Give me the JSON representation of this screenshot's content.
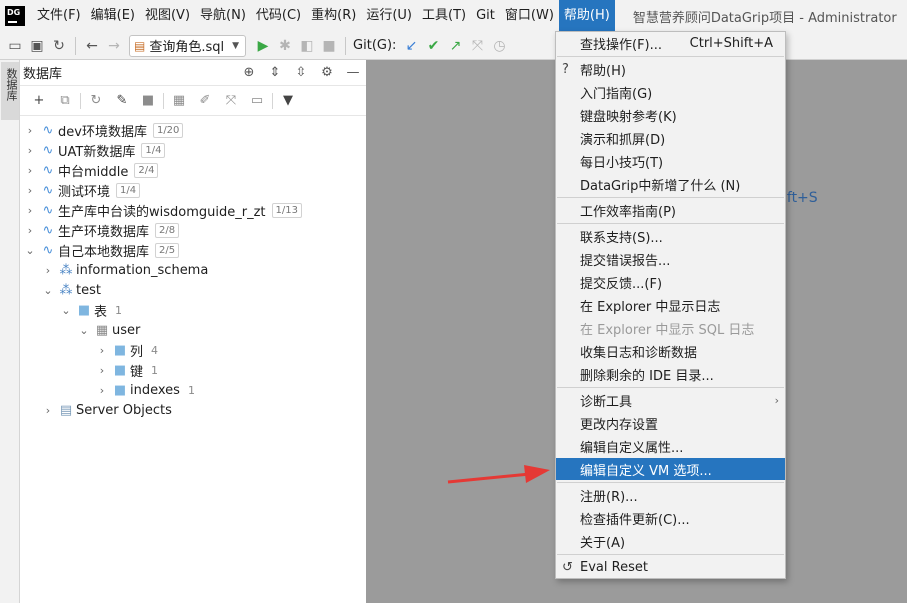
{
  "menubar": {
    "logo": "DG",
    "items": [
      "文件(F)",
      "编辑(E)",
      "视图(V)",
      "导航(N)",
      "代码(C)",
      "重构(R)",
      "运行(U)",
      "工具(T)",
      "Git",
      "窗口(W)",
      "帮助(H)"
    ],
    "active_index": 10,
    "window_title": "智慧营养顾问DataGrip项目 - Administrator"
  },
  "toolbar": {
    "run_config": "查询角色.sql",
    "git_label": "Git(G):"
  },
  "left_strip": {
    "tab_label": "数据库"
  },
  "panel": {
    "title": "数据库",
    "tree": [
      {
        "label": "dev环境数据库",
        "badge": "1/20"
      },
      {
        "label": "UAT新数据库",
        "badge": "1/4"
      },
      {
        "label": "中台middle",
        "badge": "2/4"
      },
      {
        "label": "测试环境",
        "badge": "1/4"
      },
      {
        "label": "生产库中台读的wisdomguide_r_zt",
        "badge": "1/13"
      },
      {
        "label": "生产环境数据库",
        "badge": "2/8"
      },
      {
        "label": "自己本地数据库",
        "badge": "2/5"
      },
      {
        "label": "information_schema"
      },
      {
        "label": "test"
      },
      {
        "label": "表",
        "count": "1"
      },
      {
        "label": "user"
      },
      {
        "label": "列",
        "count": "4"
      },
      {
        "label": "键",
        "count": "1"
      },
      {
        "label": "indexes",
        "count": "1"
      },
      {
        "label": "Server Objects"
      }
    ]
  },
  "editor": {
    "hint": "ift+S"
  },
  "help_menu": {
    "items": [
      {
        "label": "查找操作(F)...",
        "accel": "Ctrl+Shift+A"
      },
      {
        "label": "帮助(H)",
        "lead": "?"
      },
      {
        "label": "入门指南(G)"
      },
      {
        "label": "键盘映射参考(K)"
      },
      {
        "label": "演示和抓屏(D)"
      },
      {
        "label": "每日小技巧(T)"
      },
      {
        "label": "DataGrip中新增了什么 (N)"
      },
      {
        "label": "工作效率指南(P)"
      },
      {
        "label": "联系支持(S)..."
      },
      {
        "label": "提交错误报告..."
      },
      {
        "label": "提交反馈...(F)"
      },
      {
        "label": "在 Explorer 中显示日志"
      },
      {
        "label": "在 Explorer 中显示 SQL 日志",
        "disabled": true
      },
      {
        "label": "收集日志和诊断数据"
      },
      {
        "label": "删除剩余的 IDE 目录..."
      },
      {
        "label": "诊断工具",
        "submenu": true
      },
      {
        "label": "更改内存设置"
      },
      {
        "label": "编辑自定义属性..."
      },
      {
        "label": "编辑自定义 VM 选项...",
        "selected": true
      },
      {
        "label": "注册(R)..."
      },
      {
        "label": "检查插件更新(C)..."
      },
      {
        "label": "关于(A)"
      },
      {
        "label": "Eval Reset",
        "lead": "↺"
      }
    ]
  },
  "colors": {
    "accent": "#2675bf",
    "annotation_arrow": "#e53935",
    "background": "#9b9b9b"
  }
}
